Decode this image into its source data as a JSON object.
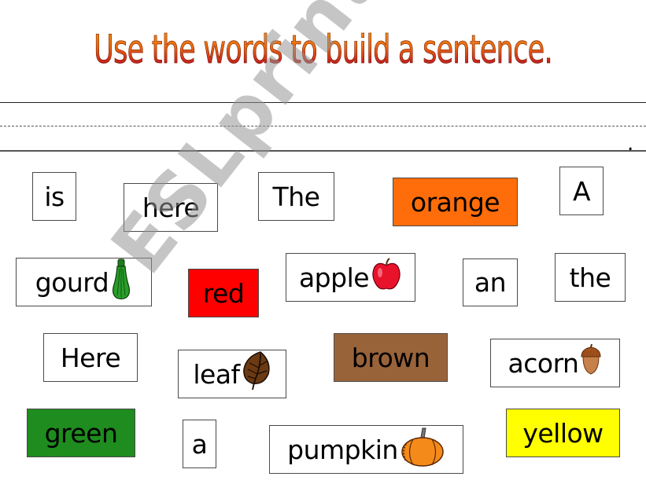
{
  "title": "Use the words to build a sentence.",
  "answer_line": {
    "end_punctuation": "."
  },
  "watermark": "ESLprintables.com",
  "cards": [
    {
      "id": "is",
      "label": "is",
      "bg": "#ffffff",
      "icon": null
    },
    {
      "id": "here",
      "label": "here",
      "bg": "#ffffff",
      "icon": null
    },
    {
      "id": "the-capital",
      "label": "The",
      "bg": "#ffffff",
      "icon": null
    },
    {
      "id": "orange",
      "label": "orange",
      "bg": "#ff6d0a",
      "icon": null
    },
    {
      "id": "a-capital",
      "label": "A",
      "bg": "#ffffff",
      "icon": null
    },
    {
      "id": "gourd",
      "label": "gourd",
      "bg": "#ffffff",
      "icon": "gourd-icon"
    },
    {
      "id": "red",
      "label": "red",
      "bg": "#ff0000",
      "icon": null
    },
    {
      "id": "apple",
      "label": "apple",
      "bg": "#ffffff",
      "icon": "apple-icon"
    },
    {
      "id": "an",
      "label": "an",
      "bg": "#ffffff",
      "icon": null
    },
    {
      "id": "the",
      "label": "the",
      "bg": "#ffffff",
      "icon": null
    },
    {
      "id": "here-capital",
      "label": "Here",
      "bg": "#ffffff",
      "icon": null
    },
    {
      "id": "leaf",
      "label": "leaf",
      "bg": "#ffffff",
      "icon": "leaf-icon"
    },
    {
      "id": "brown",
      "label": "brown",
      "bg": "#99633a",
      "icon": null
    },
    {
      "id": "acorn",
      "label": "acorn",
      "bg": "#ffffff",
      "icon": "acorn-icon"
    },
    {
      "id": "green",
      "label": "green",
      "bg": "#1e8c1e",
      "icon": null
    },
    {
      "id": "a",
      "label": "a",
      "bg": "#ffffff",
      "icon": null
    },
    {
      "id": "pumpkin",
      "label": "pumpkin",
      "bg": "#ffffff",
      "icon": "pumpkin-icon"
    },
    {
      "id": "yellow",
      "label": "yellow",
      "bg": "#ffff00",
      "icon": null
    }
  ]
}
